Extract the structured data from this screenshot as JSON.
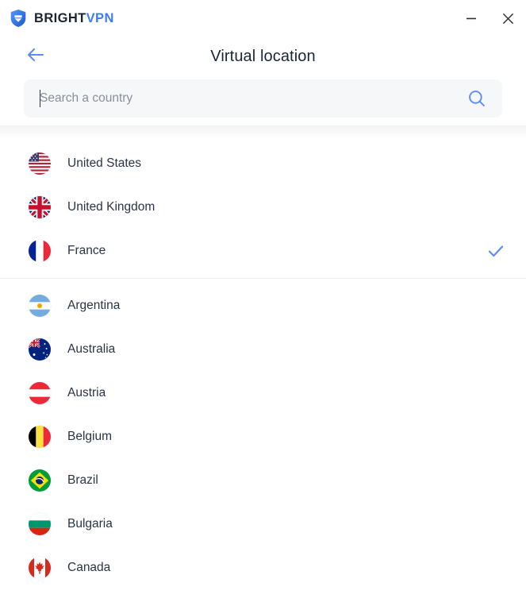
{
  "window": {
    "brand_primary": "BRIGHT",
    "brand_accent": "VPN",
    "minimize_label": "Minimize",
    "close_label": "Close",
    "accent_color": "#3c7df0",
    "brand_dark": "#1d2430"
  },
  "header": {
    "back_label": "Back",
    "title": "Virtual location"
  },
  "search": {
    "value": "",
    "placeholder": "Search a country",
    "icon": "search-icon"
  },
  "list": {
    "selected_country": "France",
    "groups": [
      {
        "name": "recommended",
        "items": [
          {
            "name": "United States",
            "flag": "us",
            "selected": false
          },
          {
            "name": "United Kingdom",
            "flag": "gb",
            "selected": false
          },
          {
            "name": "France",
            "flag": "fr",
            "selected": true
          }
        ]
      },
      {
        "name": "all-countries",
        "items": [
          {
            "name": "Argentina",
            "flag": "ar",
            "selected": false
          },
          {
            "name": "Australia",
            "flag": "au",
            "selected": false
          },
          {
            "name": "Austria",
            "flag": "at",
            "selected": false
          },
          {
            "name": "Belgium",
            "flag": "be",
            "selected": false
          },
          {
            "name": "Brazil",
            "flag": "br",
            "selected": false
          },
          {
            "name": "Bulgaria",
            "flag": "bg",
            "selected": false
          },
          {
            "name": "Canada",
            "flag": "ca",
            "selected": false
          }
        ]
      }
    ]
  }
}
